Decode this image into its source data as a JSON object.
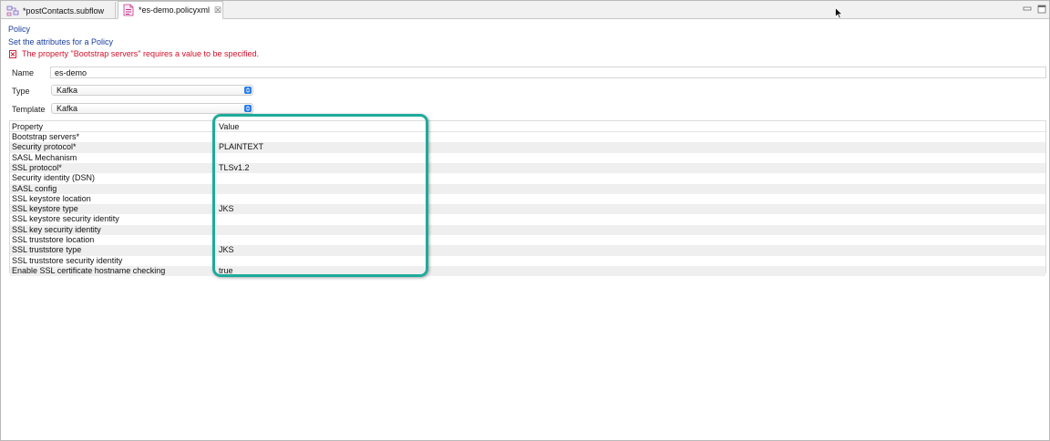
{
  "tabs": [
    {
      "label": "*postContacts.subflow",
      "icon": "subflow-icon",
      "active": false
    },
    {
      "label": "*es-demo.policyxml",
      "icon": "policy-file-icon",
      "active": true,
      "close": "☒"
    }
  ],
  "header": {
    "title": "Policy",
    "subtitle": "Set the attributes for a Policy",
    "error": "The property \"Bootstrap servers\" requires a value to be specified."
  },
  "form": {
    "name_label": "Name",
    "name_value": "es-demo",
    "type_label": "Type",
    "type_value": "Kafka",
    "template_label": "Template",
    "template_value": "Kafka"
  },
  "table": {
    "columns": [
      "Property",
      "Value"
    ],
    "rows": [
      {
        "property": "Bootstrap servers*",
        "value": ""
      },
      {
        "property": "Security protocol*",
        "value": "PLAINTEXT"
      },
      {
        "property": "SASL Mechanism",
        "value": ""
      },
      {
        "property": "SSL protocol*",
        "value": "TLSv1.2"
      },
      {
        "property": "Security identity (DSN)",
        "value": ""
      },
      {
        "property": "SASL config",
        "value": ""
      },
      {
        "property": "SSL keystore location",
        "value": ""
      },
      {
        "property": "SSL keystore type",
        "value": "JKS"
      },
      {
        "property": "SSL keystore security identity",
        "value": ""
      },
      {
        "property": "SSL key security identity",
        "value": ""
      },
      {
        "property": "SSL truststore location",
        "value": ""
      },
      {
        "property": "SSL truststore type",
        "value": "JKS"
      },
      {
        "property": "SSL truststore security identity",
        "value": ""
      },
      {
        "property": "Enable SSL certificate hostname checking",
        "value": "true"
      }
    ]
  },
  "colors": {
    "link_blue": "#1a3e9a",
    "error_red": "#d0102a",
    "highlight_teal": "#1eab9b",
    "dropdown_blue": "#2b7de9"
  }
}
